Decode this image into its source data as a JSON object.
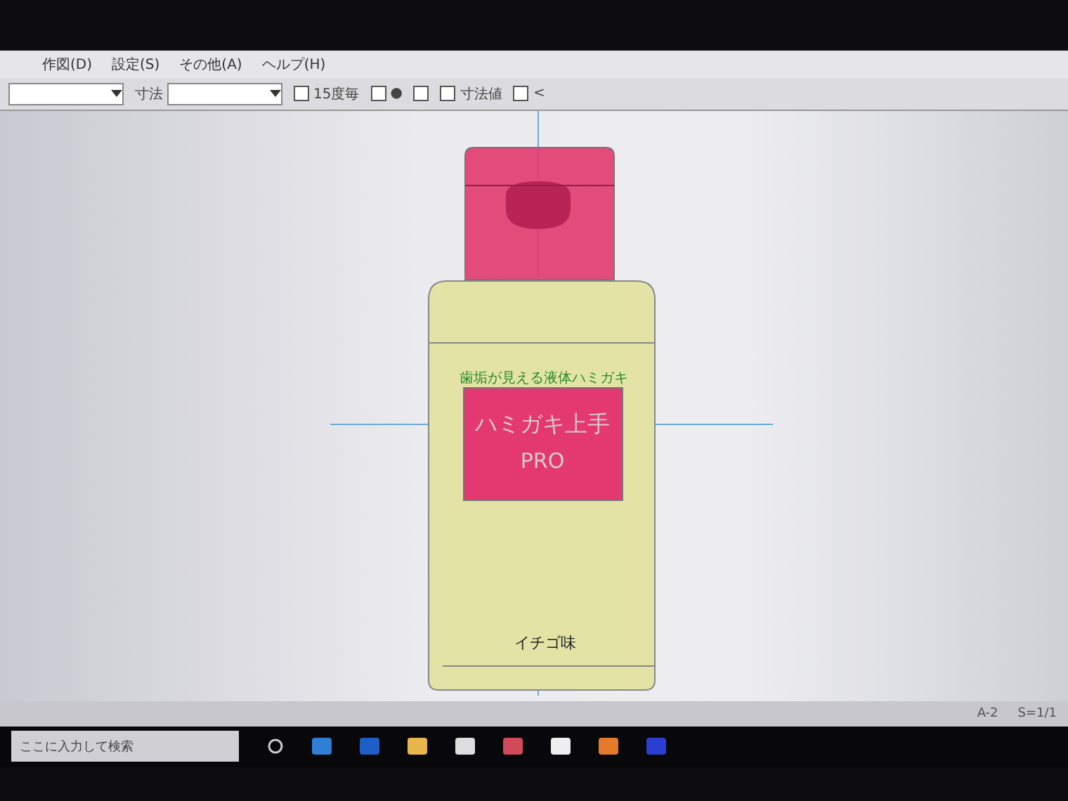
{
  "menu": [
    {
      "label": "作図(D)"
    },
    {
      "label": "設定(S)"
    },
    {
      "label": "その他(A)"
    },
    {
      "label": "ヘルプ(H)"
    }
  ],
  "toolbar": [
    {
      "kind": "select"
    },
    {
      "kind": "select",
      "label": "寸法"
    },
    {
      "kind": "checkbox",
      "label": "15度毎",
      "checked": false
    },
    {
      "kind": "checkbox",
      "label": "●",
      "checked": false
    },
    {
      "kind": "checkbox",
      "checked": false
    },
    {
      "kind": "checkbox",
      "label": "寸法値",
      "checked": false
    },
    {
      "kind": "checkbox",
      "label": "<",
      "checked": false
    }
  ],
  "drawing": {
    "tagline": "歯垢が見える液体ハミガキ",
    "product": "ハミガキ上手",
    "grade": "PRO",
    "flavor": "イチゴ味"
  },
  "status_bar": {
    "cells": [
      "A-2",
      "S=1/1"
    ]
  },
  "taskbar": {
    "search": {
      "placeholder": "ここに入力して検索"
    }
  }
}
